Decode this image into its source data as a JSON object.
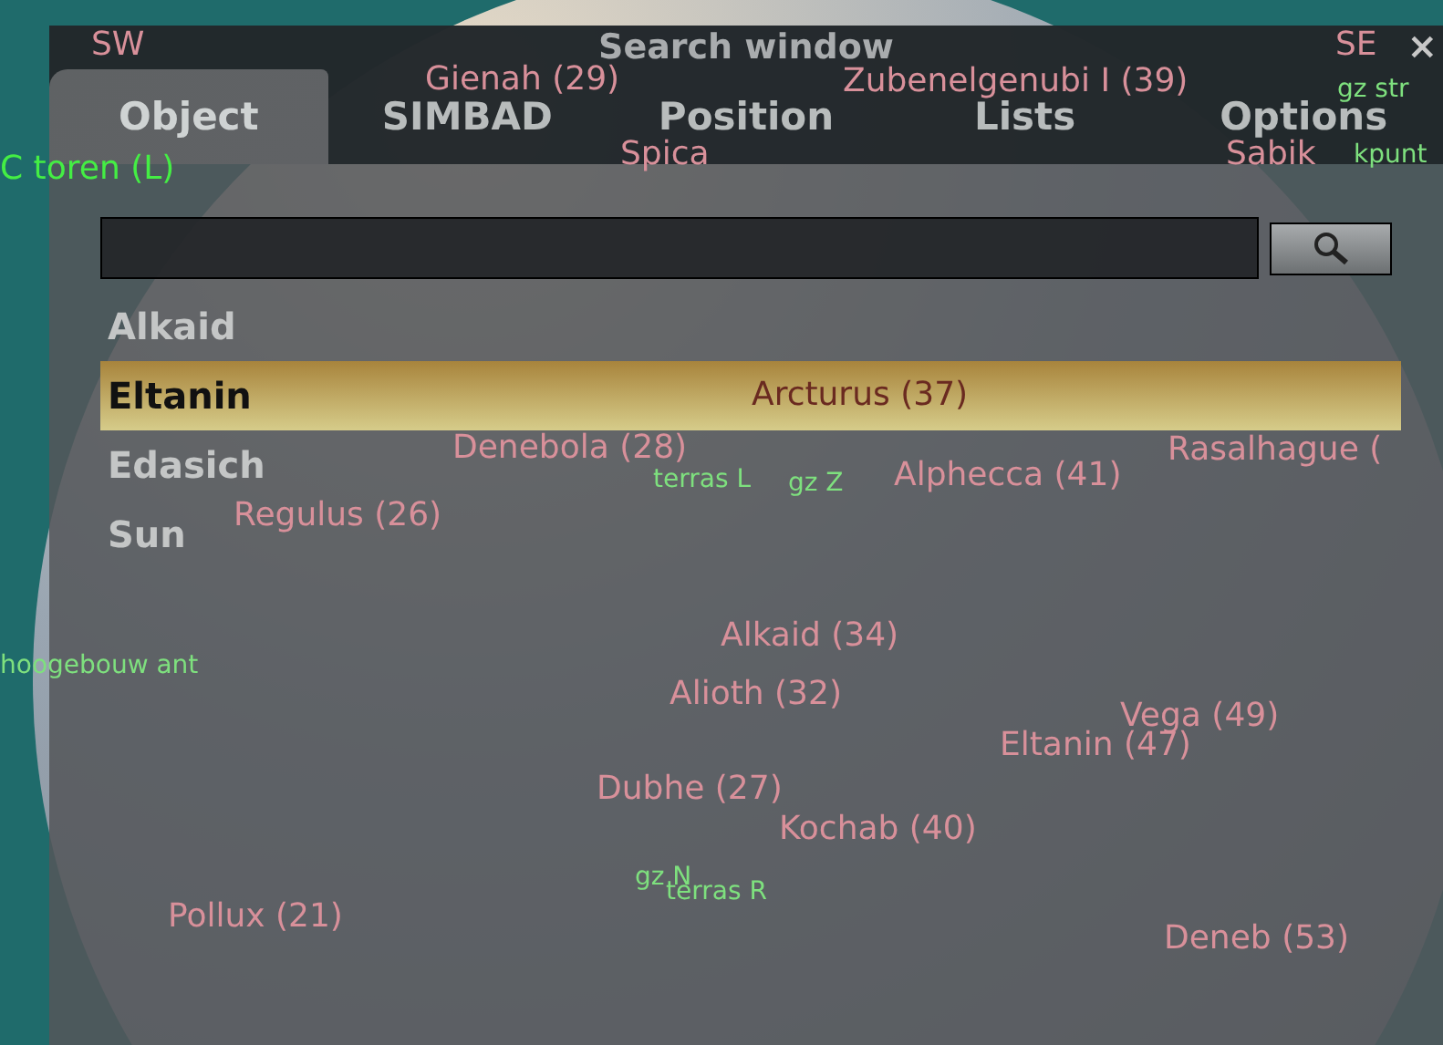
{
  "sky_labels": [
    {
      "text": "SW",
      "kind": "star"
    },
    {
      "text": "Gienah (29)",
      "kind": "star"
    },
    {
      "text": "Spica",
      "kind": "star"
    },
    {
      "text": "Zubenelgenubi I (39)",
      "kind": "star"
    },
    {
      "text": "SE",
      "kind": "star"
    },
    {
      "text": "gz str",
      "kind": "landmark"
    },
    {
      "text": "Sabik",
      "kind": "star"
    },
    {
      "text": "kpunt",
      "kind": "landmark"
    },
    {
      "text": "C toren (L)",
      "kind": "outside"
    },
    {
      "text": "Denebola (28)",
      "kind": "star"
    },
    {
      "text": "Arcturus (37)",
      "kind": "star"
    },
    {
      "text": "terras L",
      "kind": "landmark"
    },
    {
      "text": "gz Z",
      "kind": "landmark"
    },
    {
      "text": "Alphecca (41)",
      "kind": "star"
    },
    {
      "text": "Rasalhague (",
      "kind": "star"
    },
    {
      "text": "Regulus (26)",
      "kind": "star"
    },
    {
      "text": "hoogebouw ant",
      "kind": "landmark"
    },
    {
      "text": "Alkaid (34)",
      "kind": "star"
    },
    {
      "text": "Alioth (32)",
      "kind": "star"
    },
    {
      "text": "Vega (49)",
      "kind": "star"
    },
    {
      "text": "Eltanin (47)",
      "kind": "star"
    },
    {
      "text": "Dubhe (27)",
      "kind": "star"
    },
    {
      "text": "Kochab (40)",
      "kind": "star"
    },
    {
      "text": "gz N",
      "kind": "landmark"
    },
    {
      "text": "terras R",
      "kind": "landmark"
    },
    {
      "text": "Pollux (21)",
      "kind": "star"
    },
    {
      "text": "Deneb (53)",
      "kind": "star"
    }
  ],
  "window": {
    "title": "Search window",
    "close": "×"
  },
  "tabs": [
    {
      "label": "Object",
      "selected": true
    },
    {
      "label": "SIMBAD",
      "selected": false
    },
    {
      "label": "Position",
      "selected": false
    },
    {
      "label": "Lists",
      "selected": false
    },
    {
      "label": "Options",
      "selected": false
    }
  ],
  "results": [
    {
      "label": "Alkaid",
      "selected": false
    },
    {
      "label": "Eltanin",
      "selected": true
    },
    {
      "label": "Edasich",
      "selected": false
    },
    {
      "label": "Sun",
      "selected": false
    }
  ]
}
